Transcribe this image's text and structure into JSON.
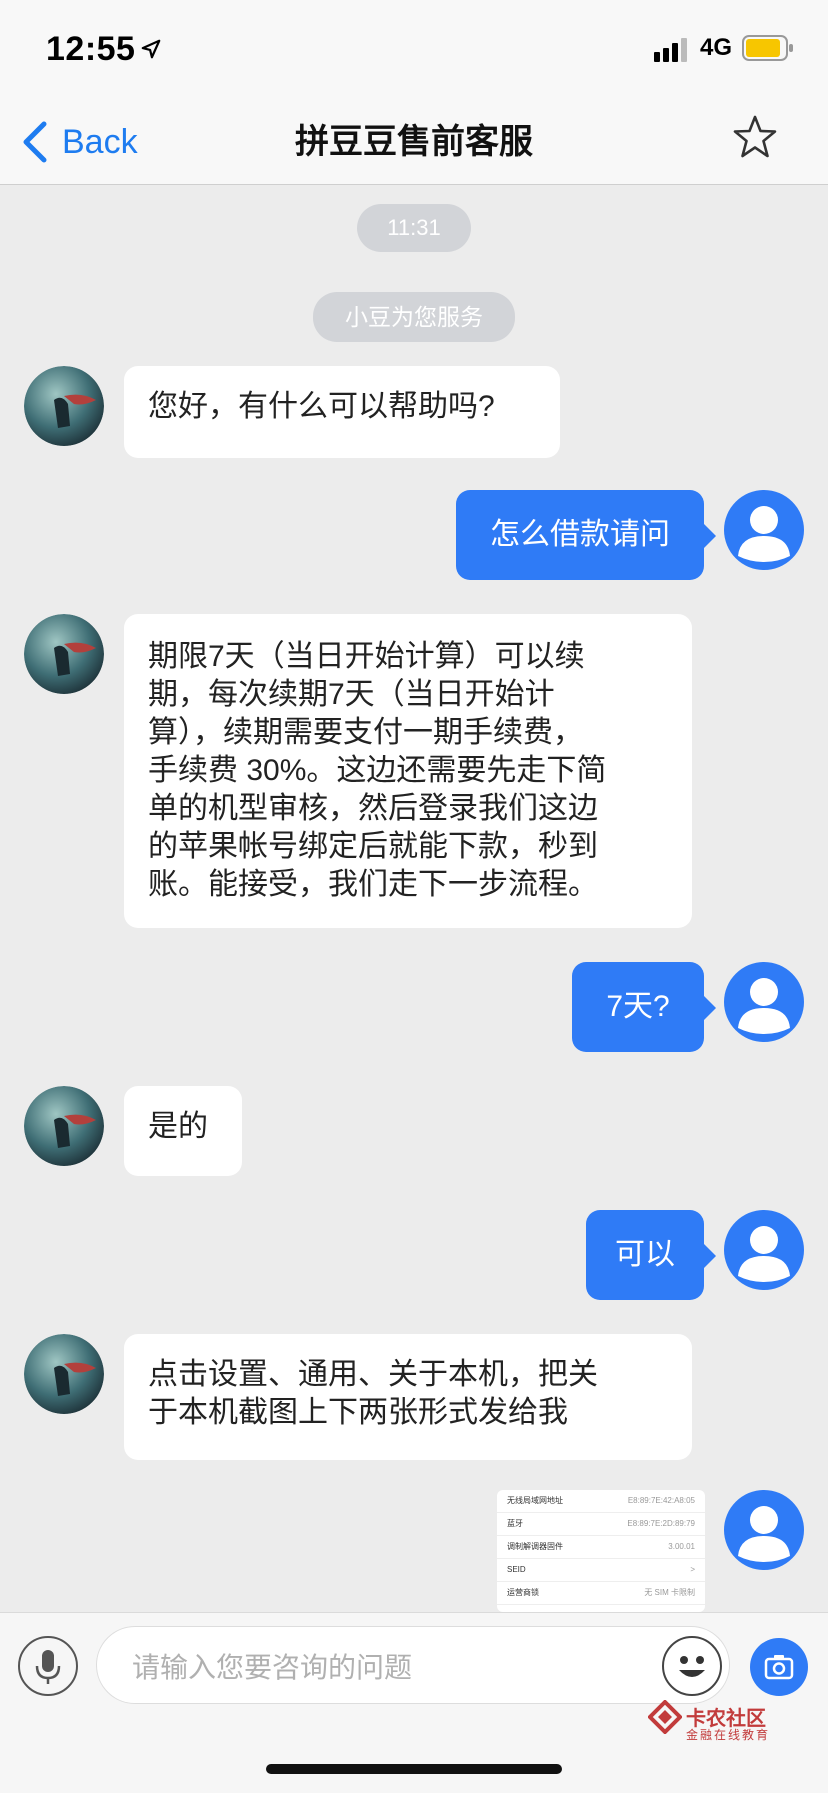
{
  "status_bar": {
    "time": "12:55",
    "network": "4G",
    "location_icon": "location-arrow-icon",
    "signal_icon": "signal-bars-icon",
    "battery_icon": "battery-icon",
    "battery_color": "#f7c600"
  },
  "nav": {
    "back_label": "Back",
    "title": "拼豆豆售前客服",
    "star_icon": "star-outline-icon"
  },
  "chat": {
    "timestamp": "11:31",
    "system_notice": "小豆为您服务",
    "messages": [
      {
        "side": "in",
        "text": "您好，有什么可以帮助吗?"
      },
      {
        "side": "out",
        "text": "怎么借款请问"
      },
      {
        "side": "in",
        "lines": [
          "期限7天（当日开始计算）可以续",
          "期，每次续期7天（当日开始计",
          "算），续期需要支付一期手续费，",
          "手续费 30%。这边还需要先走下简",
          "单的机型审核，然后登录我们这边",
          "的苹果帐号绑定后就能下款，秒到",
          "账。能接受，我们走下一步流程。"
        ]
      },
      {
        "side": "out",
        "text": "7天?"
      },
      {
        "side": "in",
        "text": "是的"
      },
      {
        "side": "out",
        "text": "可以"
      },
      {
        "side": "in",
        "lines": [
          "点击设置、通用、关于本机，把关",
          "于本机截图上下两张形式发给我"
        ]
      }
    ],
    "image_message": {
      "rows": [
        {
          "label": "无线局域网地址",
          "value": "E8:89:7E:42:A8:05"
        },
        {
          "label": "蓝牙",
          "value": "E8:89:7E:2D:89:79"
        },
        {
          "label": "调制解调器固件",
          "value": "3.00.01"
        },
        {
          "label": "SEID",
          "value": ">"
        },
        {
          "label": "运营商锁",
          "value": "无 SIM 卡限制"
        }
      ]
    }
  },
  "input_bar": {
    "placeholder": "请输入您要咨询的问题",
    "mic_icon": "microphone-icon",
    "emoji_icon": "emoji-icon",
    "camera_icon": "camera-icon"
  },
  "watermark": {
    "title": "卡农社区",
    "subtitle": "金融在线教育"
  },
  "colors": {
    "accent": "#2f7bf6",
    "link": "#1e7cf0",
    "background": "#ececec"
  }
}
